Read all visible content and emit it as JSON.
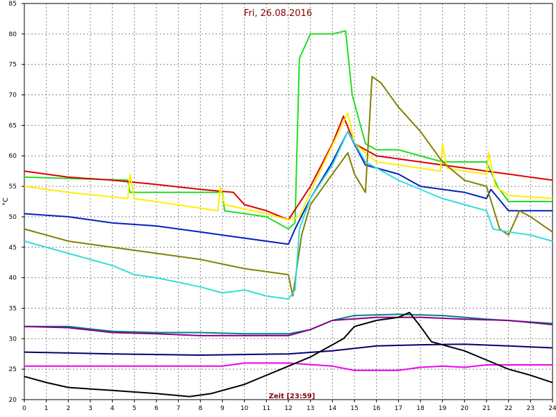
{
  "chart_data": {
    "type": "line",
    "title": "Fri, 26.08.2016",
    "xlabel": "Zeit [23:59]",
    "ylabel": "°C",
    "xlim": [
      0,
      24
    ],
    "ylim": [
      20,
      85
    ],
    "x_ticks": [
      "0",
      "1",
      "2",
      "3",
      "4",
      "5",
      "6",
      "7",
      "8",
      "9",
      "10",
      "11",
      "12",
      "13",
      "14",
      "15",
      "16",
      "17",
      "18",
      "19",
      "20",
      "21",
      "22",
      "23",
      "24"
    ],
    "y_ticks": [
      "20",
      "25",
      "30",
      "35",
      "40",
      "45",
      "50",
      "55",
      "60",
      "65",
      "70",
      "75",
      "80",
      "85"
    ],
    "grid": true,
    "series": [
      {
        "color": "#22dd22",
        "points": [
          [
            0,
            56.5
          ],
          [
            4.7,
            56
          ],
          [
            4.8,
            54
          ],
          [
            9,
            54
          ],
          [
            9.1,
            51
          ],
          [
            11,
            50
          ],
          [
            12,
            48
          ],
          [
            12.3,
            49
          ],
          [
            12.5,
            76
          ],
          [
            13,
            80
          ],
          [
            14,
            80
          ],
          [
            14.6,
            80.5
          ],
          [
            14.9,
            70
          ],
          [
            15.5,
            62
          ],
          [
            16,
            61
          ],
          [
            17,
            61
          ],
          [
            19,
            59
          ],
          [
            20,
            59
          ],
          [
            21,
            59
          ],
          [
            21.5,
            55
          ],
          [
            22,
            52.5
          ],
          [
            24,
            52.5
          ]
        ]
      },
      {
        "color": "#dd0000",
        "points": [
          [
            0,
            57.5
          ],
          [
            2,
            56.5
          ],
          [
            4,
            56
          ],
          [
            6,
            55.3
          ],
          [
            8,
            54.5
          ],
          [
            9.5,
            54
          ],
          [
            10,
            52
          ],
          [
            11,
            51
          ],
          [
            12,
            49.5
          ],
          [
            13,
            55
          ],
          [
            14,
            62
          ],
          [
            14.5,
            66.5
          ],
          [
            15,
            62
          ],
          [
            16,
            60
          ],
          [
            18,
            59
          ],
          [
            20,
            58
          ],
          [
            21,
            57.5
          ],
          [
            22,
            57
          ],
          [
            24,
            56
          ]
        ]
      },
      {
        "color": "#ffee00",
        "points": [
          [
            0,
            55
          ],
          [
            2,
            54
          ],
          [
            4.7,
            53
          ],
          [
            4.8,
            57
          ],
          [
            5,
            53
          ],
          [
            8.8,
            51
          ],
          [
            8.9,
            55
          ],
          [
            9.1,
            52
          ],
          [
            11,
            50.5
          ],
          [
            12,
            49.5
          ],
          [
            12.5,
            50
          ],
          [
            13.5,
            58
          ],
          [
            14.7,
            67
          ],
          [
            15,
            62
          ],
          [
            16,
            59
          ],
          [
            17,
            58.5
          ],
          [
            18.9,
            57.5
          ],
          [
            19,
            62
          ],
          [
            19.2,
            58
          ],
          [
            20,
            57.5
          ],
          [
            21,
            57
          ],
          [
            21.1,
            60.5
          ],
          [
            21.4,
            55
          ],
          [
            22,
            53.5
          ],
          [
            24,
            53
          ]
        ]
      },
      {
        "color": "#0022bb",
        "points": [
          [
            0,
            50.5
          ],
          [
            2,
            50
          ],
          [
            4,
            49
          ],
          [
            6,
            48.5
          ],
          [
            8,
            47.5
          ],
          [
            9,
            47
          ],
          [
            10,
            46.5
          ],
          [
            11,
            46
          ],
          [
            12,
            45.5
          ],
          [
            12.3,
            48
          ],
          [
            13,
            53
          ],
          [
            14,
            59
          ],
          [
            14.7,
            64
          ],
          [
            15.5,
            58.5
          ],
          [
            17,
            57
          ],
          [
            18,
            55
          ],
          [
            19,
            54.5
          ],
          [
            20,
            54
          ],
          [
            21,
            53
          ],
          [
            21.2,
            54.5
          ],
          [
            22,
            51
          ],
          [
            24,
            51
          ]
        ]
      },
      {
        "color": "#808000",
        "points": [
          [
            0,
            48
          ],
          [
            1,
            47
          ],
          [
            2,
            46
          ],
          [
            4,
            45
          ],
          [
            6,
            44
          ],
          [
            8,
            43
          ],
          [
            10,
            41.5
          ],
          [
            12,
            40.5
          ],
          [
            12.2,
            37
          ],
          [
            12.6,
            47
          ],
          [
            13,
            52
          ],
          [
            14,
            57
          ],
          [
            14.7,
            60.5
          ],
          [
            15,
            57
          ],
          [
            15.5,
            54
          ],
          [
            15.8,
            73
          ],
          [
            16.2,
            72
          ],
          [
            17,
            68
          ],
          [
            18,
            64
          ],
          [
            19,
            59
          ],
          [
            20,
            56
          ],
          [
            21,
            55
          ],
          [
            21.6,
            48
          ],
          [
            22,
            47
          ],
          [
            22.5,
            51
          ],
          [
            23,
            50
          ],
          [
            24,
            47.5
          ]
        ]
      },
      {
        "color": "#33dddd",
        "points": [
          [
            0,
            46
          ],
          [
            2,
            44
          ],
          [
            4,
            42
          ],
          [
            5,
            40.5
          ],
          [
            6,
            40
          ],
          [
            8,
            38.5
          ],
          [
            9,
            37.5
          ],
          [
            10,
            38
          ],
          [
            11,
            37
          ],
          [
            12,
            36.5
          ],
          [
            12.3,
            38
          ],
          [
            12.5,
            48
          ],
          [
            13,
            53
          ],
          [
            14,
            58.5
          ],
          [
            14.7,
            64
          ],
          [
            15.5,
            59
          ],
          [
            17,
            56
          ],
          [
            18,
            54.5
          ],
          [
            19,
            53
          ],
          [
            20,
            52
          ],
          [
            21,
            51
          ],
          [
            21.3,
            48
          ],
          [
            22,
            47.5
          ],
          [
            23,
            47
          ],
          [
            24,
            46
          ]
        ]
      },
      {
        "color": "#008080",
        "points": [
          [
            0,
            32
          ],
          [
            2,
            32
          ],
          [
            4,
            31.2
          ],
          [
            6,
            31
          ],
          [
            8,
            31
          ],
          [
            10,
            30.8
          ],
          [
            12,
            30.8
          ],
          [
            13,
            31.5
          ],
          [
            14,
            33
          ],
          [
            15,
            33.8
          ],
          [
            17,
            34
          ],
          [
            19,
            33.8
          ],
          [
            21,
            33.2
          ],
          [
            24,
            32.5
          ]
        ]
      },
      {
        "color": "#880088",
        "points": [
          [
            0,
            32
          ],
          [
            2,
            31.8
          ],
          [
            4,
            31
          ],
          [
            6,
            30.8
          ],
          [
            8,
            30.5
          ],
          [
            10,
            30.5
          ],
          [
            12,
            30.5
          ],
          [
            13,
            31.5
          ],
          [
            14,
            33
          ],
          [
            16,
            33.5
          ],
          [
            18,
            33.5
          ],
          [
            20,
            33.2
          ],
          [
            22,
            33
          ],
          [
            24,
            32.3
          ]
        ]
      },
      {
        "color": "#000070",
        "points": [
          [
            0,
            27.8
          ],
          [
            4,
            27.5
          ],
          [
            8,
            27.3
          ],
          [
            12,
            27.5
          ],
          [
            14,
            28
          ],
          [
            16,
            28.8
          ],
          [
            18,
            29
          ],
          [
            20,
            29.1
          ],
          [
            22,
            28.8
          ],
          [
            24,
            28.5
          ]
        ]
      },
      {
        "color": "#ee00ee",
        "points": [
          [
            0,
            25.5
          ],
          [
            5,
            25.5
          ],
          [
            9,
            25.5
          ],
          [
            10,
            26
          ],
          [
            12,
            26
          ],
          [
            14,
            25.5
          ],
          [
            15,
            24.8
          ],
          [
            17,
            24.8
          ],
          [
            18,
            25.3
          ],
          [
            19,
            25.5
          ],
          [
            20,
            25.3
          ],
          [
            21,
            25.7
          ],
          [
            24,
            25.7
          ]
        ]
      },
      {
        "color": "#000000",
        "points": [
          [
            0,
            23.8
          ],
          [
            1,
            22.8
          ],
          [
            2,
            22
          ],
          [
            4,
            21.5
          ],
          [
            6,
            21
          ],
          [
            7.5,
            20.5
          ],
          [
            8.5,
            21
          ],
          [
            10,
            22.5
          ],
          [
            11,
            24
          ],
          [
            12,
            25.5
          ],
          [
            13,
            27
          ],
          [
            14,
            29
          ],
          [
            14.5,
            30
          ],
          [
            15,
            32
          ],
          [
            16,
            33
          ],
          [
            17,
            33.5
          ],
          [
            17.5,
            34.3
          ],
          [
            18,
            32
          ],
          [
            18.5,
            29.5
          ],
          [
            19,
            29
          ],
          [
            20,
            28
          ],
          [
            21,
            26.5
          ],
          [
            22,
            25
          ],
          [
            23,
            24
          ],
          [
            24,
            22.8
          ]
        ]
      }
    ]
  }
}
